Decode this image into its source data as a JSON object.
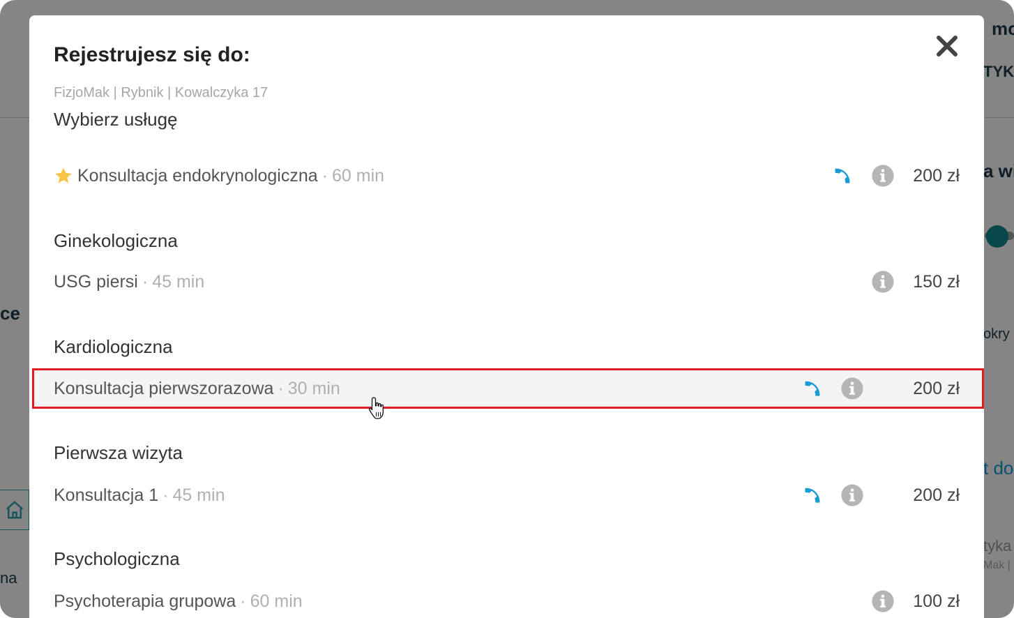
{
  "background": {
    "top_right_fragment": "mo",
    "right_fragment_1": "TYKU",
    "right_fragment_2": "a wi",
    "right_fragment_3": "okry",
    "right_fragment_4": "t do",
    "right_fragment_5": "tyka",
    "right_fragment_6": "Mak |",
    "left_fragment_1": "ce",
    "left_fragment_2": "na"
  },
  "modal": {
    "title": "Rejestrujesz się do:",
    "location": "FizjoMak | Rybnik | Kowalczyka 17",
    "subtitle": "Wybierz usługę",
    "close_icon": "close-icon"
  },
  "featured": {
    "name": "Konsultacja endokrynologiczna",
    "separator": "·",
    "duration": "60 min",
    "price": "200 zł",
    "phone": true
  },
  "categories": [
    {
      "title": "Ginekologiczna",
      "services": [
        {
          "name": "USG piersi",
          "separator": "·",
          "duration": "45 min",
          "price": "150 zł",
          "phone": false
        }
      ]
    },
    {
      "title": "Kardiologiczna",
      "services": [
        {
          "name": "Konsultacja pierwszorazowa",
          "separator": "·",
          "duration": "30 min",
          "price": "200 zł",
          "phone": true
        }
      ]
    },
    {
      "title": "Pierwsza wizyta",
      "services": [
        {
          "name": "Konsultacja 1",
          "separator": "·",
          "duration": "45 min",
          "price": "200 zł",
          "phone": true
        }
      ]
    },
    {
      "title": "Psychologiczna",
      "services": [
        {
          "name": "Psychoterapia grupowa",
          "separator": "·",
          "duration": "60 min",
          "price": "100 zł",
          "phone": false
        }
      ]
    }
  ],
  "colors": {
    "phone": "#1a9ad6",
    "info": "#b5b5b5",
    "highlight_border": "#e01b24",
    "star": "#f6c443"
  }
}
